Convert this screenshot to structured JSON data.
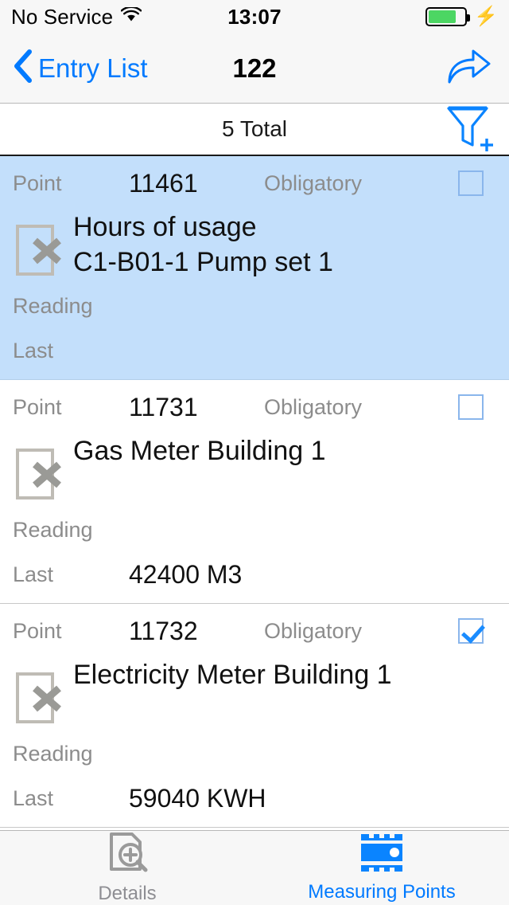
{
  "status_bar": {
    "carrier": "No Service",
    "wifi_icon": "wifi-icon",
    "time": "13:07",
    "battery_icon": "battery-icon",
    "battery_level_pct": 78,
    "charging_icon": "lightning-bolt-icon",
    "battery_color": "#4cd663"
  },
  "nav_bar": {
    "back_icon": "chevron-left-icon",
    "back_label": "Entry List",
    "title": "122",
    "share_icon": "share-forward-arrow-icon",
    "accent_color": "#007aff"
  },
  "filter_bar": {
    "total_label": "5 Total",
    "filter_icon": "funnel-plus-icon"
  },
  "list": {
    "labels": {
      "point": "Point",
      "obligatory": "Obligatory",
      "reading": "Reading",
      "last": "Last"
    },
    "row_icon": "document-deleted-x-icon",
    "rows": [
      {
        "point": "11461",
        "obligatory_checked": false,
        "title_line1": "Hours of usage",
        "title_line2": "C1-B01-1   Pump set 1",
        "reading": "",
        "last": "",
        "selected": true
      },
      {
        "point": "11731",
        "obligatory_checked": false,
        "title_line1": "Gas Meter Building 1",
        "title_line2": "",
        "reading": "",
        "last": "42400 M3",
        "selected": false
      },
      {
        "point": "11732",
        "obligatory_checked": true,
        "title_line1": "Electricity Meter Building 1",
        "title_line2": "",
        "reading": "",
        "last": "59040 KWH",
        "selected": false
      }
    ],
    "selected_row_color": "#c3dffb"
  },
  "tab_bar": {
    "tabs": [
      {
        "label": "Details",
        "icon": "document-magnifier-plus-icon",
        "active": false
      },
      {
        "label": "Measuring Points",
        "icon": "gauge-meter-icon",
        "active": true
      }
    ],
    "active_color": "#007aff",
    "inactive_color": "#8e8e93"
  }
}
